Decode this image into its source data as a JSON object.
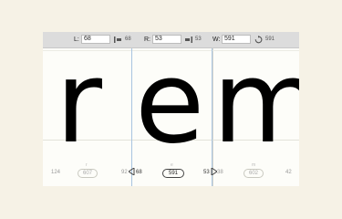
{
  "toolbar": {
    "left_label": "L:",
    "left_value": "68",
    "left_after": "68",
    "right_label": "R:",
    "right_value": "53",
    "right_after": "53",
    "width_label": "W:",
    "width_value": "591",
    "width_after": "591"
  },
  "glyphs": [
    {
      "char": "r",
      "width": "",
      "sidebearings": [
        "124",
        "92"
      ]
    },
    {
      "char": "e",
      "width": "591",
      "sidebearings": [
        "68",
        "53"
      ]
    },
    {
      "char": "m",
      "width": "",
      "sidebearings": [
        "38",
        "42"
      ]
    }
  ],
  "labels": {
    "r_width": "607",
    "e_width": "591",
    "m_width": "602",
    "r_mark": "r",
    "e_mark": "e",
    "m_mark": "m"
  },
  "icons": [
    "align-left-icon",
    "align-right-icon",
    "reset-icon"
  ]
}
